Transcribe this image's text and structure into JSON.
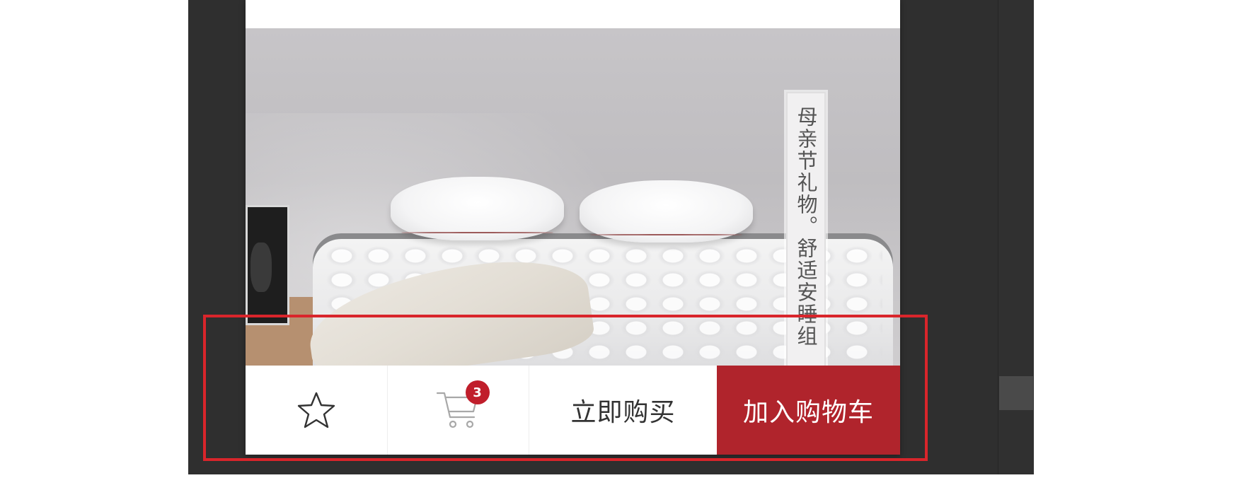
{
  "product": {
    "banner_text": "母亲节礼物。舒适安睡组"
  },
  "action_bar": {
    "favorite_icon": "star-outline-icon",
    "cart_icon": "shopping-cart-icon",
    "cart_count": "3",
    "buy_now_label": "立即购买",
    "add_to_cart_label": "加入购物车"
  },
  "colors": {
    "accent": "#b0242c",
    "badge": "#c01e2b",
    "highlight": "#d9252b",
    "panel": "#2f2f2f"
  }
}
